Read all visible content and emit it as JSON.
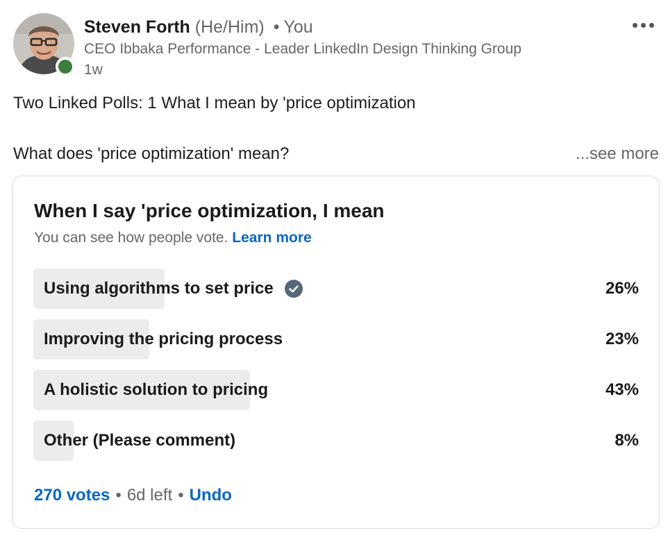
{
  "author": {
    "name": "Steven Forth",
    "pronouns": "(He/Him)",
    "separator": "•",
    "relation": "You",
    "headline": "CEO Ibbaka Performance - Leader LinkedIn Design Thinking Group",
    "timestamp": "1w",
    "avatar_icon": "profile-photo",
    "presence_color": "#3b7d3f"
  },
  "post": {
    "line1": "Two Linked Polls: 1 What I mean by 'price optimization",
    "line2": "What does 'price optimization' mean?",
    "see_more": "...see more"
  },
  "poll": {
    "question": "When I say 'price optimization, I mean",
    "visibility_text": "You can see how people vote.",
    "learn_more": "Learn more",
    "options": [
      {
        "label": "Using algorithms to set price",
        "percent_text": "26%",
        "percent": 26,
        "selected": true
      },
      {
        "label": "Improving the pricing process",
        "percent_text": "23%",
        "percent": 23,
        "selected": false
      },
      {
        "label": "A holistic solution to pricing",
        "percent_text": "43%",
        "percent": 43,
        "selected": false
      },
      {
        "label": "Other (Please comment)",
        "percent_text": "8%",
        "percent": 8,
        "selected": false
      }
    ],
    "votes": "270 votes",
    "separator": "•",
    "time_left": "6d left",
    "undo": "Undo"
  },
  "colors": {
    "link": "#0a66c2",
    "bar_fill": "#ececec",
    "check": "#56687a"
  }
}
